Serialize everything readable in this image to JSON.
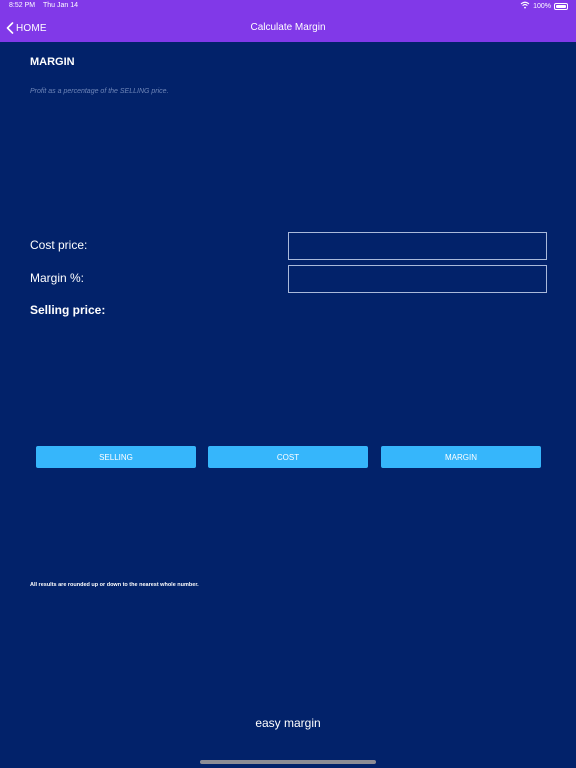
{
  "status_bar": {
    "time": "8:52 PM",
    "date": "Thu Jan 14",
    "battery": "100%"
  },
  "nav": {
    "back_label": "HOME",
    "title": "Calculate Margin"
  },
  "section": {
    "title": "MARGIN",
    "description": "Profit as a percentage of the SELLING price."
  },
  "form": {
    "cost_label": "Cost price:",
    "cost_value": "",
    "margin_label": "Margin %:",
    "margin_value": "",
    "result_label": "Selling price:"
  },
  "buttons": {
    "selling": "SELLING",
    "cost": "COST",
    "margin": "MARGIN"
  },
  "footnote": "All results are rounded up or down to the nearest whole number.",
  "footer": {
    "app_name": "easy margin"
  },
  "colors": {
    "background": "#02226a",
    "nav_bar": "#8139e8",
    "button": "#36b6fb",
    "description_text": "#6f86b8"
  }
}
